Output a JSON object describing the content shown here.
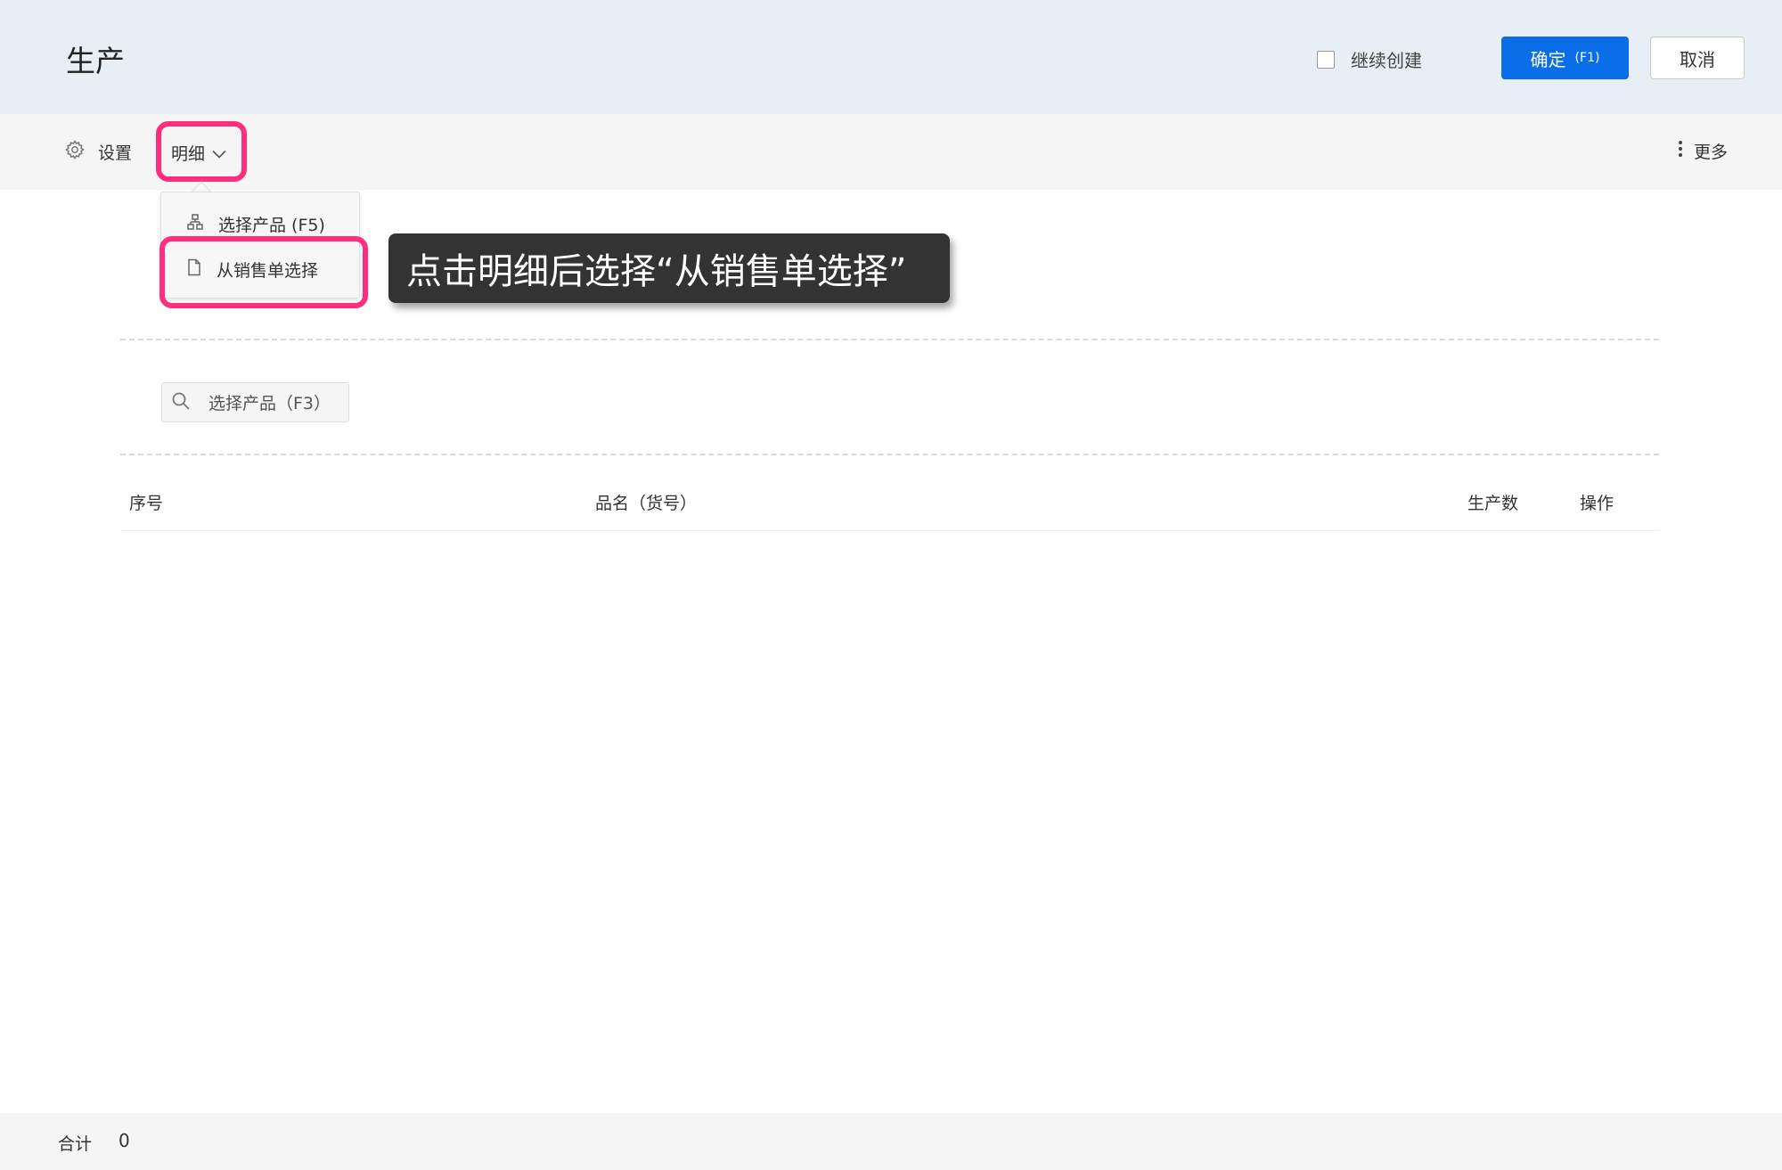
{
  "header": {
    "title": "生产",
    "continue_label": "继续创建",
    "confirm_label": "确定",
    "confirm_key": "(F1)",
    "cancel_label": "取消"
  },
  "toolbar": {
    "settings_label": "设置",
    "detail_label": "明细",
    "more_label": "更多"
  },
  "dropdown": {
    "items": [
      {
        "label": "选择产品 (F5)",
        "icon": "product-tree-icon"
      },
      {
        "label": "从销售单选择",
        "icon": "document-icon"
      }
    ]
  },
  "annotation": {
    "tooltip_text": "点击明细后选择“从销售单选择”",
    "highlight_color": "#ff2e7e"
  },
  "search": {
    "placeholder": "选择产品（F3）"
  },
  "table": {
    "columns": [
      "序号",
      "品名（货号）",
      "生产数",
      "操作"
    ]
  },
  "footer": {
    "total_label": "合计",
    "total_value": "0"
  },
  "colors": {
    "primary": "#0a6ee8",
    "header_bg": "#e8eef5",
    "toolbar_bg": "#f5f5f5"
  }
}
